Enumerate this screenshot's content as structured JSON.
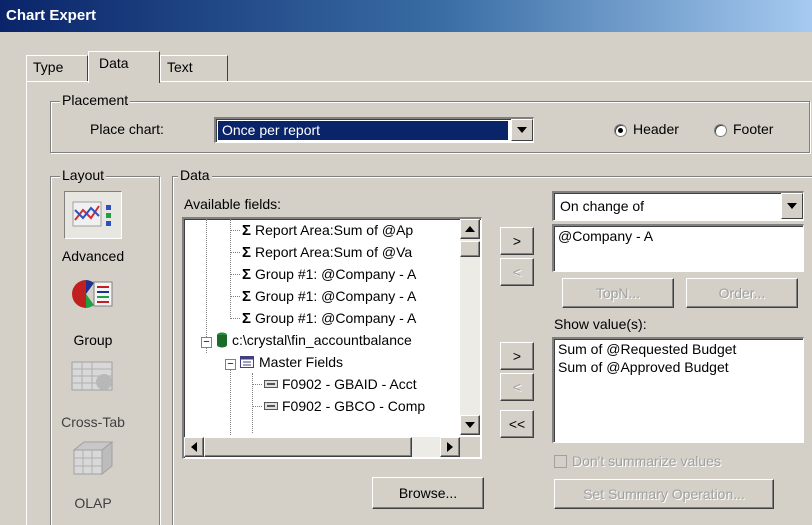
{
  "window": {
    "title": "Chart Expert"
  },
  "tabs": [
    {
      "label": "Type",
      "active": false
    },
    {
      "label": "Data",
      "active": true
    },
    {
      "label": "Text",
      "active": false
    }
  ],
  "placement": {
    "group_label": "Placement",
    "place_chart_label": "Place chart:",
    "place_chart_value": "Once per report",
    "header_label": "Header",
    "footer_label": "Footer",
    "selected": "Header"
  },
  "layout": {
    "group_label": "Layout",
    "items": [
      {
        "label": "Advanced",
        "icon": "advanced-chart-icon",
        "selected": true
      },
      {
        "label": "Group",
        "icon": "group-chart-icon",
        "selected": false
      },
      {
        "label": "Cross-Tab",
        "icon": "cross-tab-icon",
        "selected": false
      },
      {
        "label": "OLAP",
        "icon": "olap-icon",
        "selected": false
      }
    ]
  },
  "data": {
    "group_label": "Data",
    "available_fields_label": "Available fields:",
    "fields": [
      "Report Area:Sum of @Ap",
      "Report Area:Sum of @Va",
      "Group #1: @Company - A",
      "Group #1: @Company - A",
      "Group #1: @Company - A",
      "c:\\crystal\\fin_accountbalance",
      "Master Fields",
      "F0902 - GBAID - Acct",
      "F0902 - GBCO - Comp"
    ],
    "browse_label": "Browse...",
    "on_change_value": "On change of",
    "on_change_items": [
      "@Company - A"
    ],
    "topn_label": "TopN...",
    "order_label": "Order...",
    "show_values_label": "Show value(s):",
    "show_values_items": [
      "Sum of @Requested Budget",
      "Sum of @Approved Budget"
    ],
    "dont_summarize_label": "Don't summarize values",
    "set_summary_label": "Set Summary Operation...",
    "add_label": ">",
    "remove_label": "<",
    "remove_all_label": "<<"
  },
  "colors": {
    "title_bar": "#0a246a",
    "dialog_bg": "#d4d0c8",
    "field_select": "#0a246a"
  }
}
